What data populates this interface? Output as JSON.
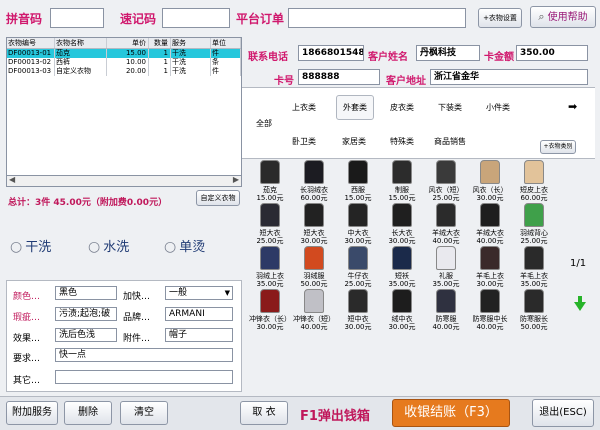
{
  "top": {
    "pinyin_label": "拼音码",
    "quickcode_label": "速记码",
    "platform_label": "平台订单",
    "garment_settings_btn": "+衣物设置",
    "help_btn": "使用帮助"
  },
  "table": {
    "headers": [
      "衣物编号",
      "衣物名称",
      "单价",
      "数量",
      "服务",
      "单位"
    ],
    "rows": [
      {
        "id": "DF00013-01",
        "name": "茄克",
        "price": "15.00",
        "qty": "1",
        "service": "干洗",
        "unit": "件"
      },
      {
        "id": "DF00013-02",
        "name": "西裤",
        "price": "10.00",
        "qty": "1",
        "service": "干洗",
        "unit": "条"
      },
      {
        "id": "DF00013-03",
        "name": "自定义衣物",
        "price": "20.00",
        "qty": "1",
        "service": "干洗",
        "unit": "件"
      }
    ],
    "total": "总计：3件  45.00元（附加费0.00元）",
    "custom_btn": "自定义衣物"
  },
  "services": [
    "干洗",
    "水洗",
    "单烫"
  ],
  "attrs": {
    "color_label": "颜色",
    "color_value": "黑色",
    "speed_label": "加快",
    "speed_value": "一般",
    "flaw_label": "瑕疵",
    "flaw_value": "污渍;起泡;破",
    "brand_label": "品牌",
    "brand_value": "ARMANI",
    "effect_label": "效果",
    "effect_value": "洗后色浅",
    "accessory_label": "附件",
    "accessory_value": "帽子",
    "request_label": "要求",
    "request_value": "快一点",
    "other_label": "其它",
    "other_value": ""
  },
  "customer": {
    "phone_label": "联系电话",
    "phone": "18668015483",
    "name_label": "客户姓名",
    "name": "丹枫科技",
    "balance_label": "卡金额",
    "balance": "350.00",
    "card_label": "卡号",
    "card": "888888",
    "address_label": "客户地址",
    "address": "浙江省金华"
  },
  "categories": {
    "all": "全部",
    "row1": [
      "上衣类",
      "外套类",
      "皮衣类",
      "下装类",
      "小件类"
    ],
    "row2": [
      "卧卫类",
      "家居类",
      "特殊类",
      "商品销售"
    ],
    "category_btn": "+衣物类别"
  },
  "garments": [
    {
      "name": "茄克",
      "price": "15.00元",
      "color": "#2a2a2a"
    },
    {
      "name": "长羽绒衣",
      "price": "60.00元",
      "color": "#1c1c22"
    },
    {
      "name": "西服",
      "price": "15.00元",
      "color": "#1a1a1a"
    },
    {
      "name": "制服",
      "price": "15.00元",
      "color": "#2c2c2c"
    },
    {
      "name": "风衣（短）",
      "price": "25.00元",
      "color": "#3a3a3a"
    },
    {
      "name": "风衣（长）",
      "price": "30.00元",
      "color": "#c9a57a"
    },
    {
      "name": "短皮上衣",
      "price": "60.00元",
      "color": "#e2c39a"
    },
    {
      "name": "短大衣",
      "price": "25.00元",
      "color": "#2a2a33"
    },
    {
      "name": "短大衣",
      "price": "30.00元",
      "color": "#222222"
    },
    {
      "name": "中大衣",
      "price": "30.00元",
      "color": "#242424"
    },
    {
      "name": "长大衣",
      "price": "30.00元",
      "color": "#1f1f1f"
    },
    {
      "name": "羊绒大衣",
      "price": "40.00元",
      "color": "#2b2b2b"
    },
    {
      "name": "羊绒大衣",
      "price": "40.00元",
      "color": "#1e1e1e"
    },
    {
      "name": "羽绒背心",
      "price": "25.00元",
      "color": "#3fa04a"
    },
    {
      "name": "羽绒上衣",
      "price": "35.00元",
      "color": "#2d3a66"
    },
    {
      "name": "羽绒服",
      "price": "50.00元",
      "color": "#d24a1f"
    },
    {
      "name": "牛仔衣",
      "price": "25.00元",
      "color": "#3a4a6a"
    },
    {
      "name": "短袄",
      "price": "35.00元",
      "color": "#1b2a4a"
    },
    {
      "name": "礼服",
      "price": "35.00元",
      "color": "#e9e9ee"
    },
    {
      "name": "羊毛上衣",
      "price": "30.00元",
      "color": "#3a2a2a"
    },
    {
      "name": "羊毛上衣",
      "price": "35.00元",
      "color": "#2a2a2a"
    },
    {
      "name": "冲锋衣（长）",
      "price": "30.00元",
      "color": "#8a1a1a"
    },
    {
      "name": "冲锋衣（短）",
      "price": "40.00元",
      "color": "#c0c0c6"
    },
    {
      "name": "短中衣",
      "price": "30.00元",
      "color": "#2a2a2a"
    },
    {
      "name": "绒中衣",
      "price": "30.00元",
      "color": "#1d1d1d"
    },
    {
      "name": "防寒服",
      "price": "40.00元",
      "color": "#2f3140"
    },
    {
      "name": "防寒服中长",
      "price": "40.00元",
      "color": "#222222"
    },
    {
      "name": "防寒服长",
      "price": "50.00元",
      "color": "#2a2a2a"
    }
  ],
  "pager": {
    "page": "1/1"
  },
  "bottom": {
    "extra_service": "附加服务",
    "delete": "删除",
    "clear": "清空",
    "take": "取 衣",
    "cash_drawer": "F1弹出钱箱",
    "checkout": "收银结账（F3）",
    "exit": "退出(ESC)"
  }
}
